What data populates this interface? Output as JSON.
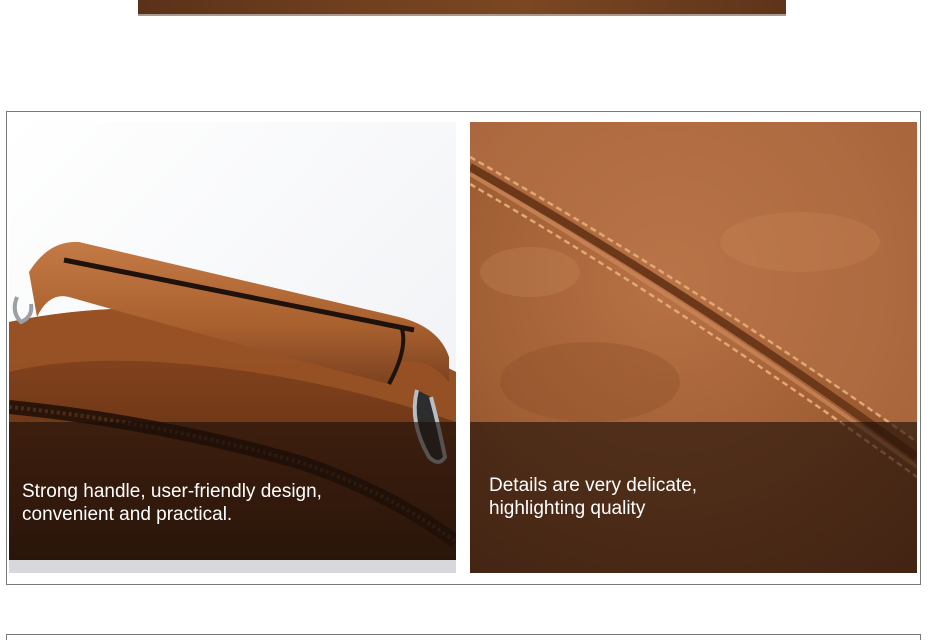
{
  "panels": [
    {
      "caption_line1": "Strong handle, user-friendly design,",
      "caption_line2": "convenient and practical."
    },
    {
      "caption_line1": "Details are very delicate,",
      "caption_line2": "highlighting quality"
    }
  ],
  "colors": {
    "leather_brown": "#a8602e",
    "dark_brown": "#5a3219",
    "stitch": "#d9a066",
    "frame_border": "#7a7a7a",
    "caption_overlay": "rgba(28,14,8,0.62)"
  }
}
